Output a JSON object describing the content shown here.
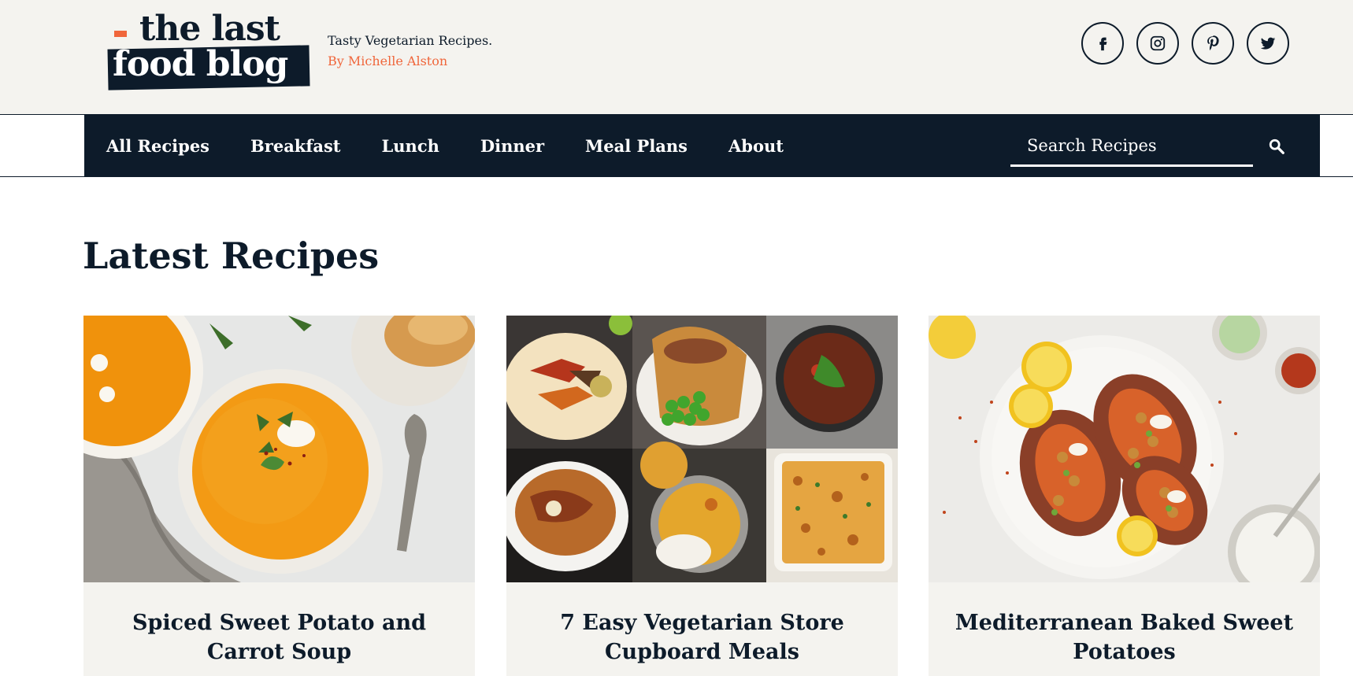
{
  "site": {
    "logo_line1": "the last",
    "logo_line2": "food blog",
    "tagline": "Tasty Vegetarian Recipes.",
    "byline": "By Michelle Alston"
  },
  "socials": [
    {
      "name": "facebook-icon"
    },
    {
      "name": "instagram-icon"
    },
    {
      "name": "pinterest-icon"
    },
    {
      "name": "twitter-icon"
    }
  ],
  "nav": {
    "items": [
      "All Recipes",
      "Breakfast",
      "Lunch",
      "Dinner",
      "Meal Plans",
      "About"
    ],
    "search_placeholder": "Search Recipes"
  },
  "main": {
    "title": "Latest Recipes",
    "cards": [
      {
        "title": "Spiced Sweet Potato and Carrot Soup"
      },
      {
        "title": "7 Easy Vegetarian Store Cupboard Meals"
      },
      {
        "title": "Mediterranean Baked Sweet Potatoes"
      }
    ]
  },
  "colors": {
    "navy": "#0d1b2a",
    "accent": "#f0663b",
    "cream": "#f4f3ef"
  }
}
